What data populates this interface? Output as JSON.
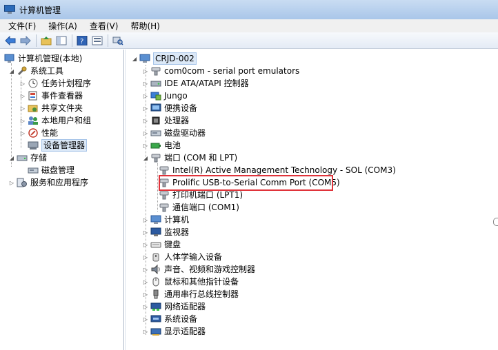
{
  "window": {
    "title": "计算机管理"
  },
  "menu": [
    "文件(F)",
    "操作(A)",
    "查看(V)",
    "帮助(H)"
  ],
  "left_tree": [
    {
      "label": "计算机管理(本地)",
      "level": 0,
      "expander": "",
      "icon": "computer-management-icon"
    },
    {
      "label": "系统工具",
      "level": 1,
      "expander": "◢",
      "icon": "tools-icon"
    },
    {
      "label": "任务计划程序",
      "level": 2,
      "expander": "▷",
      "icon": "clock-icon"
    },
    {
      "label": "事件查看器",
      "level": 2,
      "expander": "▷",
      "icon": "event-viewer-icon"
    },
    {
      "label": "共享文件夹",
      "level": 2,
      "expander": "▷",
      "icon": "shared-folder-icon"
    },
    {
      "label": "本地用户和组",
      "level": 2,
      "expander": "▷",
      "icon": "users-icon"
    },
    {
      "label": "性能",
      "level": 2,
      "expander": "▷",
      "icon": "performance-icon"
    },
    {
      "label": "设备管理器",
      "level": 2,
      "expander": "",
      "icon": "device-manager-icon",
      "selected": true
    },
    {
      "label": "存储",
      "level": 1,
      "expander": "◢",
      "icon": "storage-icon"
    },
    {
      "label": "磁盘管理",
      "level": 2,
      "expander": "",
      "icon": "disk-icon"
    },
    {
      "label": "服务和应用程序",
      "level": 1,
      "expander": "▷",
      "icon": "services-icon"
    }
  ],
  "right_tree": [
    {
      "label": "CRJD-002",
      "level": 0,
      "expander": "◢",
      "icon": "computer-icon"
    },
    {
      "label": "com0com - serial port emulators",
      "level": 1,
      "expander": "▷",
      "icon": "port-icon"
    },
    {
      "label": "IDE ATA/ATAPI 控制器",
      "level": 1,
      "expander": "▷",
      "icon": "ide-icon"
    },
    {
      "label": "Jungo",
      "level": 1,
      "expander": "▷",
      "icon": "jungo-icon"
    },
    {
      "label": "便携设备",
      "level": 1,
      "expander": "▷",
      "icon": "portable-icon"
    },
    {
      "label": "处理器",
      "level": 1,
      "expander": "▷",
      "icon": "cpu-icon"
    },
    {
      "label": "磁盘驱动器",
      "level": 1,
      "expander": "▷",
      "icon": "disk-drive-icon"
    },
    {
      "label": "电池",
      "level": 1,
      "expander": "▷",
      "icon": "battery-icon"
    },
    {
      "label": "端口 (COM 和 LPT)",
      "level": 1,
      "expander": "◢",
      "icon": "port-icon"
    },
    {
      "label": "Intel(R) Active Management Technology - SOL (COM3)",
      "level": 2,
      "expander": "",
      "icon": "port-icon"
    },
    {
      "label": "Prolific USB-to-Serial Comm Port (COM5)",
      "level": 2,
      "expander": "",
      "icon": "port-icon"
    },
    {
      "label": "打印机端口 (LPT1)",
      "level": 2,
      "expander": "",
      "icon": "port-icon"
    },
    {
      "label": "通信端口 (COM1)",
      "level": 2,
      "expander": "",
      "icon": "port-icon"
    },
    {
      "label": "计算机",
      "level": 1,
      "expander": "▷",
      "icon": "computer-icon"
    },
    {
      "label": "监视器",
      "level": 1,
      "expander": "▷",
      "icon": "monitor-icon"
    },
    {
      "label": "键盘",
      "level": 1,
      "expander": "▷",
      "icon": "keyboard-icon"
    },
    {
      "label": "人体学输入设备",
      "level": 1,
      "expander": "▷",
      "icon": "hid-icon"
    },
    {
      "label": "声音、视频和游戏控制器",
      "level": 1,
      "expander": "▷",
      "icon": "sound-icon"
    },
    {
      "label": "鼠标和其他指针设备",
      "level": 1,
      "expander": "▷",
      "icon": "mouse-icon"
    },
    {
      "label": "通用串行总线控制器",
      "level": 1,
      "expander": "▷",
      "icon": "usb-icon"
    },
    {
      "label": "网络适配器",
      "level": 1,
      "expander": "▷",
      "icon": "network-icon"
    },
    {
      "label": "系统设备",
      "level": 1,
      "expander": "▷",
      "icon": "system-device-icon"
    },
    {
      "label": "显示适配器",
      "level": 1,
      "expander": "▷",
      "icon": "display-adapter-icon"
    }
  ]
}
